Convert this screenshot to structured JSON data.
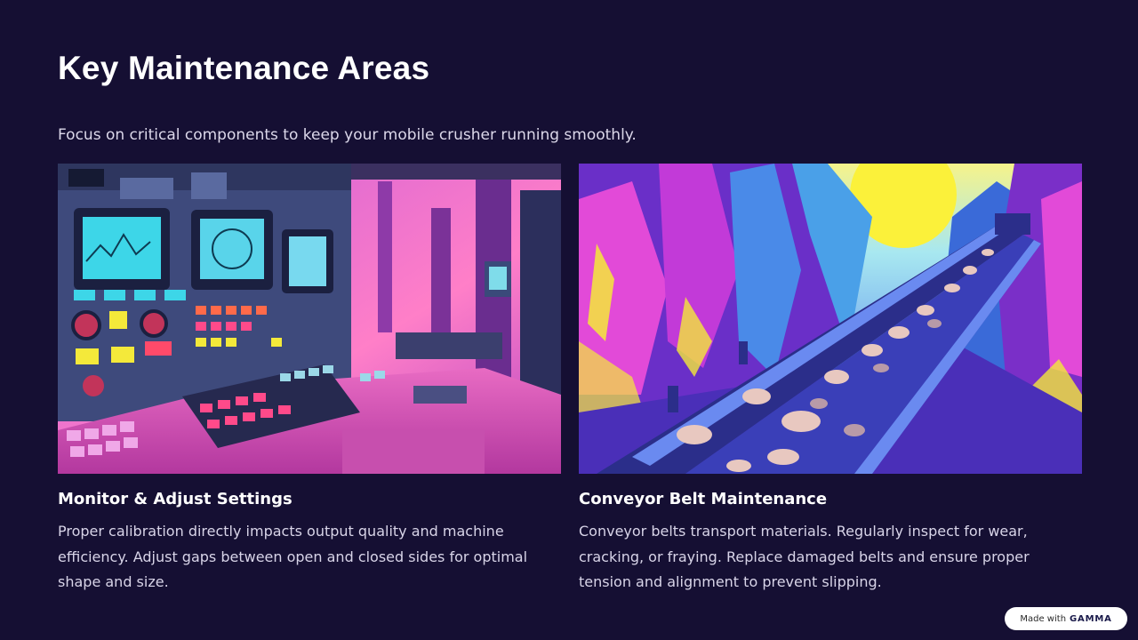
{
  "slide": {
    "title": "Key Maintenance Areas",
    "subtitle": "Focus on critical components to keep your mobile crusher running smoothly."
  },
  "cards": [
    {
      "heading": "Monitor & Adjust Settings",
      "body": "Proper calibration directly impacts output quality and machine efficiency. Adjust gaps between open and closed sides for optimal shape and size."
    },
    {
      "heading": "Conveyor Belt Maintenance",
      "body": "Conveyor belts transport materials. Regularly inspect for wear, cracking, or fraying. Replace damaged belts and ensure proper tension and alignment to prevent slipping."
    }
  ],
  "badge": {
    "prefix": "Made with",
    "brand": "GAMMA"
  },
  "colors": {
    "background": "#150f33",
    "accent_pink": "#ff5fb8",
    "accent_yellow": "#f4e93a",
    "accent_blue": "#3b4bd8"
  }
}
